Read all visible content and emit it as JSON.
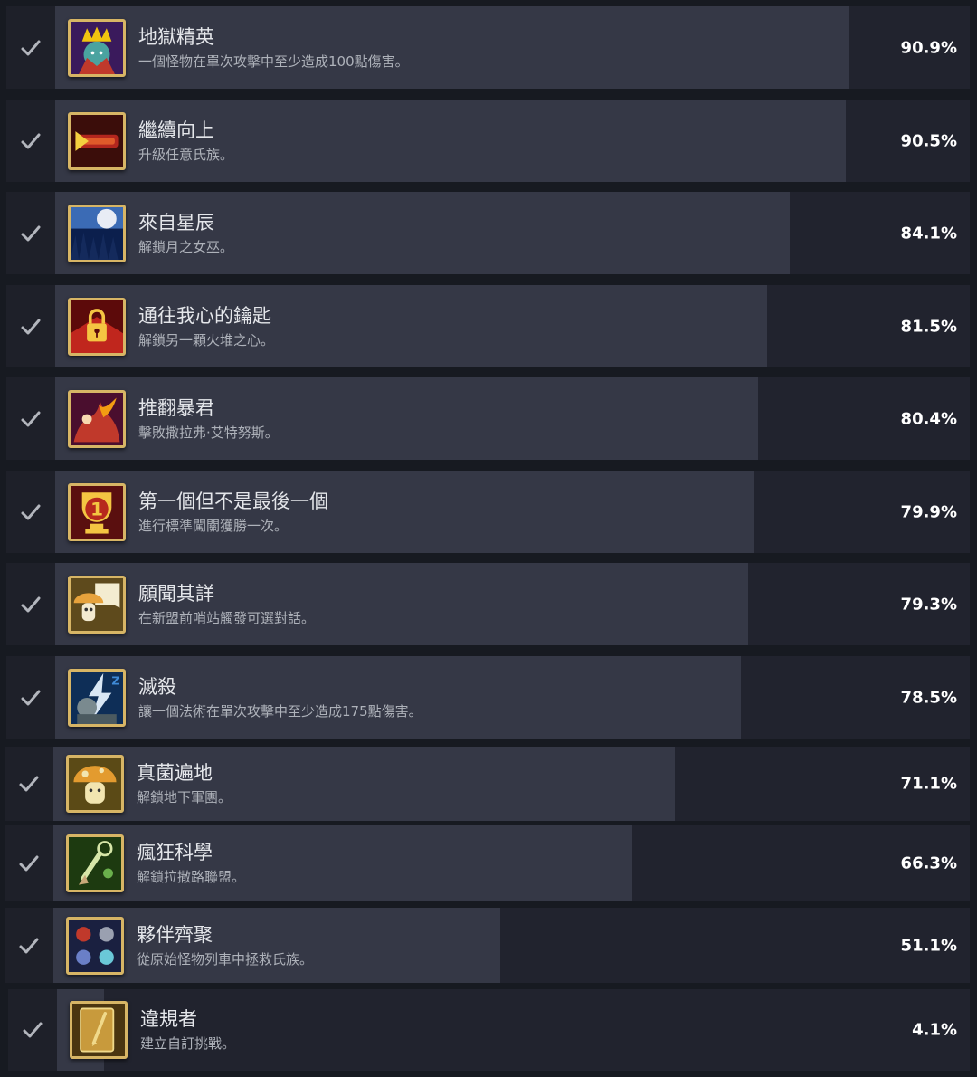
{
  "achievements": [
    {
      "title": "地獄精英",
      "description": "一個怪物在單次攻擊中至少造成100點傷害。",
      "percent_text": "90.9%",
      "percent": 90.9,
      "icon": "demon-lord-icon",
      "colors": [
        "#3a1a5c",
        "#c0392b",
        "#f1c40f"
      ]
    },
    {
      "title": "繼續向上",
      "description": "升級任意氏族。",
      "percent_text": "90.5%",
      "percent": 90.5,
      "icon": "arrow-bar-icon",
      "colors": [
        "#3b0d0a",
        "#b3261e",
        "#f4d03f"
      ]
    },
    {
      "title": "來自星辰",
      "description": "解鎖月之女巫。",
      "percent_text": "84.1%",
      "percent": 84.1,
      "icon": "moon-forest-icon",
      "colors": [
        "#0b1f4d",
        "#3b6bb5",
        "#e8ecf5"
      ]
    },
    {
      "title": "通往我心的鑰匙",
      "description": "解鎖另一顆火堆之心。",
      "percent_text": "81.5%",
      "percent": 81.5,
      "icon": "heart-lock-icon",
      "colors": [
        "#5c0a0a",
        "#c0261d",
        "#f5c542"
      ]
    },
    {
      "title": "推翻暴君",
      "description": "擊敗撒拉弗·艾特努斯。",
      "percent_text": "80.4%",
      "percent": 80.4,
      "icon": "tyrant-icon",
      "colors": [
        "#4a0e2e",
        "#c0392b",
        "#f39c12"
      ]
    },
    {
      "title": "第一個但不是最後一個",
      "description": "進行標準闖關獲勝一次。",
      "percent_text": "79.9%",
      "percent": 79.9,
      "icon": "trophy-one-icon",
      "colors": [
        "#5a0f0f",
        "#b7281d",
        "#f4c542"
      ]
    },
    {
      "title": "願聞其詳",
      "description": "在新盟前哨站觸發可選對話。",
      "percent_text": "79.3%",
      "percent": 79.3,
      "icon": "mushroom-speech-icon",
      "colors": [
        "#5e4a1c",
        "#e6a23c",
        "#f3ecd0"
      ]
    },
    {
      "title": "滅殺",
      "description": "讓一個法術在單次攻擊中至少造成175點傷害。",
      "percent_text": "78.5%",
      "percent": 78.5,
      "icon": "lightning-golem-icon",
      "colors": [
        "#0e2e57",
        "#3f8ad6",
        "#d9e7f5"
      ]
    },
    {
      "title": "真菌遍地",
      "description": "解鎖地下軍團。",
      "percent_text": "71.1%",
      "percent": 71.1,
      "icon": "mushroom-icon",
      "colors": [
        "#5b4a16",
        "#e39b2f",
        "#f2e5b0"
      ]
    },
    {
      "title": "瘋狂科學",
      "description": "解鎖拉撒路聯盟。",
      "percent_text": "66.3%",
      "percent": 66.3,
      "icon": "mad-science-icon",
      "colors": [
        "#1d3a10",
        "#6ab04c",
        "#d6e6a8"
      ]
    },
    {
      "title": "夥伴齊聚",
      "description": "從原始怪物列車中拯救氏族。",
      "percent_text": "51.1%",
      "percent": 51.1,
      "icon": "clan-group-icon",
      "colors": [
        "#1a2040",
        "#c0392b",
        "#6ac8d8"
      ]
    },
    {
      "title": "違規者",
      "description": "建立自訂挑戰。",
      "percent_text": "4.1%",
      "percent": 4.1,
      "icon": "scroll-pen-icon",
      "colors": [
        "#4a3510",
        "#c89a3c",
        "#f0d98a"
      ]
    }
  ]
}
